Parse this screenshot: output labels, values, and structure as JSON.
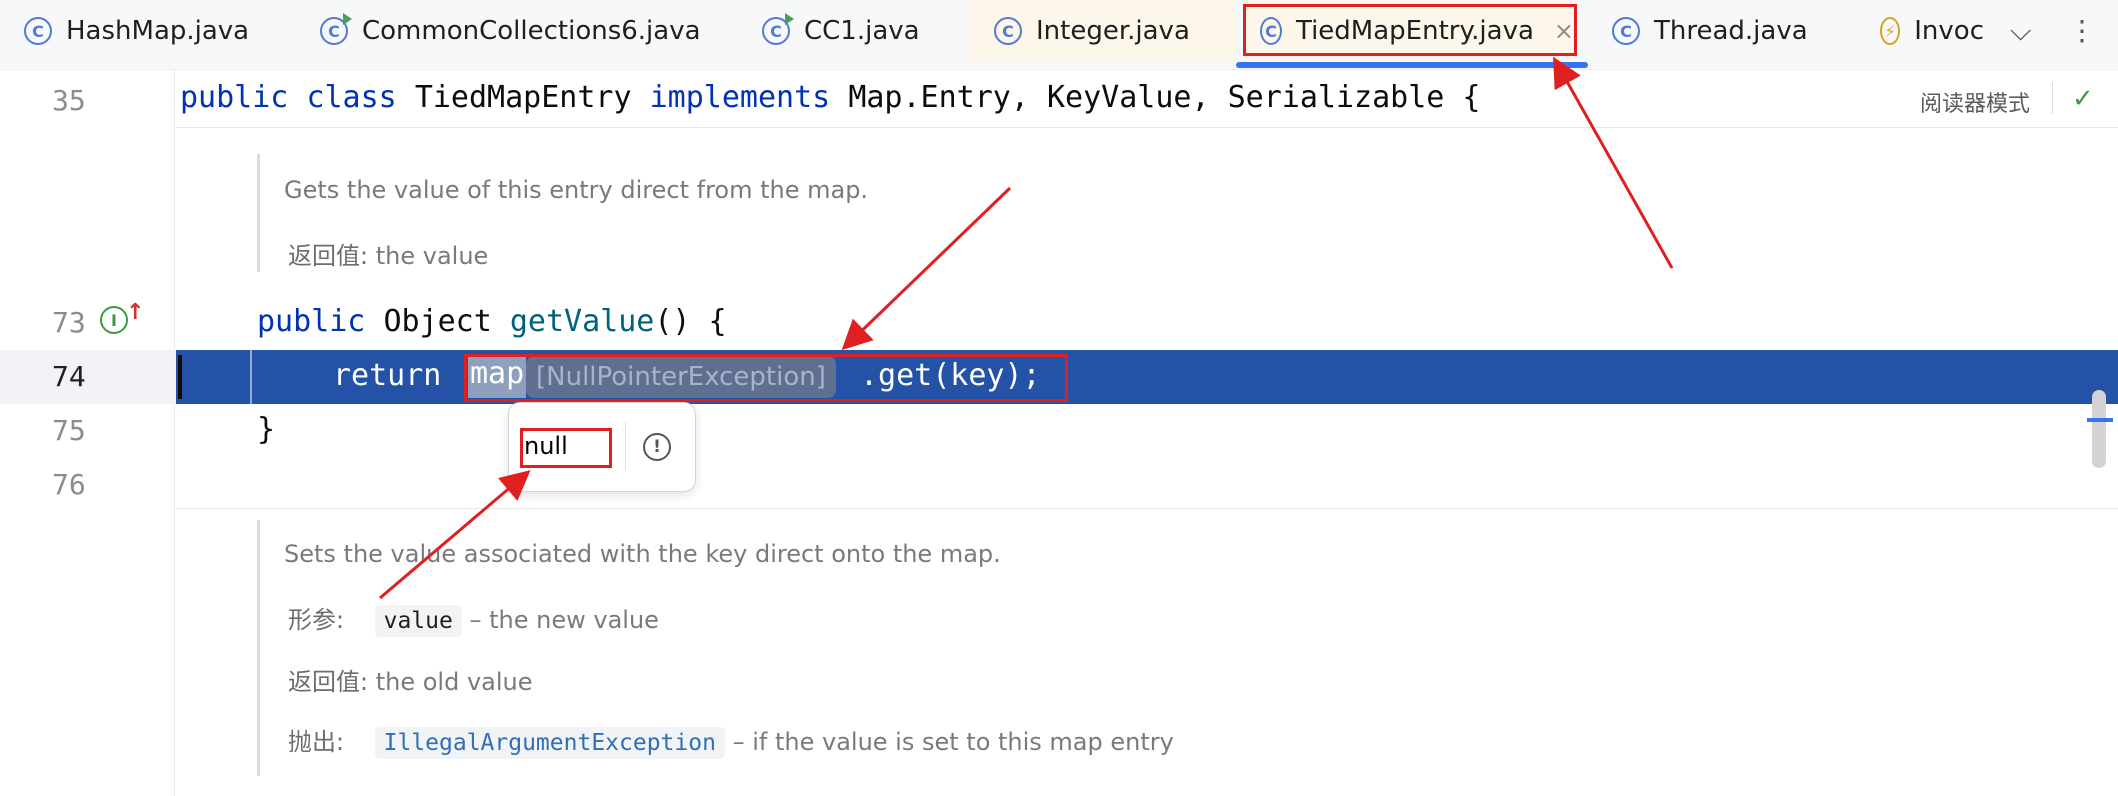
{
  "tabs": [
    {
      "label": "HashMap.java",
      "icon": "C",
      "icon_type": "class"
    },
    {
      "label": "CommonCollections6.java",
      "icon": "C",
      "icon_type": "run"
    },
    {
      "label": "CC1.java",
      "icon": "C",
      "icon_type": "run"
    },
    {
      "label": "Integer.java",
      "icon": "C",
      "icon_type": "class-lib"
    },
    {
      "label": "TiedMapEntry.java",
      "icon": "C",
      "icon_type": "class",
      "active": true,
      "close": "×"
    },
    {
      "label": "Thread.java",
      "icon": "C",
      "icon_type": "class"
    },
    {
      "label": "Invoc",
      "icon": "⚡",
      "icon_type": "lightning"
    }
  ],
  "tab_more": {
    "chevron": "⌵",
    "kebab": "⋮"
  },
  "editor": {
    "reader_mode": "阅读器模式",
    "check_mark": "✓",
    "sticky_line_number": "35",
    "sticky_code": {
      "kw1": "public",
      "kw2": "class",
      "name": "TiedMapEntry",
      "kw3": "implements",
      "rest": "Map.Entry, KeyValue, Serializable {"
    },
    "line_numbers": [
      "73",
      "74",
      "75",
      "76"
    ],
    "doc1": {
      "summary": "Gets the value of this entry direct from the map.",
      "returns_label": "返回值:",
      "returns_text": "the value"
    },
    "line73": {
      "kw": "public",
      "type": "Object",
      "fn": "getValue",
      "rest": "() {"
    },
    "line74": {
      "kw": "return",
      "map_token": "map",
      "inlay": "[NullPointerException]",
      "rest": ".get(key);"
    },
    "line75": "}",
    "gutter_icon": "I",
    "gutter_arrow": "↑",
    "popup": {
      "value": "null",
      "icon": "!"
    },
    "doc2": {
      "summary": "Sets the value associated with the key direct onto the map.",
      "param_label": "形参:",
      "param_code": "value",
      "param_text": "– the new value",
      "returns_label": "返回值:",
      "returns_text": "the old value",
      "throws_label": "抛出:",
      "throws_code": "IllegalArgumentException",
      "throws_text": "– if the value is set to this map entry"
    }
  },
  "colors": {
    "accent": "#3574f0",
    "selection": "#2352a6",
    "annotation_red": "#e02020",
    "keyword": "#0033b3",
    "function": "#00627a"
  }
}
